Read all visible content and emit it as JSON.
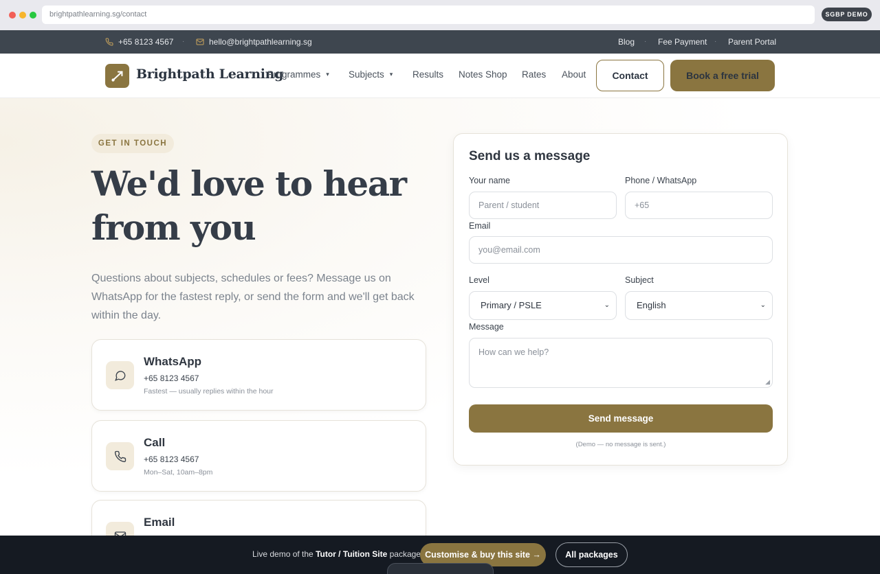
{
  "browser": {
    "url": "brightpathlearning.sg/contact",
    "badge": "SGBP DEMO"
  },
  "topbar": {
    "phone": "+65 8123 4567",
    "email": "hello@brightpathlearning.sg",
    "links": [
      "Blog",
      "Fee Payment",
      "Parent Portal"
    ]
  },
  "nav": {
    "brand": "Brightpath Learning",
    "items": [
      "Programmes",
      "Subjects",
      "Results",
      "Notes Shop",
      "Rates",
      "About"
    ],
    "contact_label": "Contact",
    "cta_label": "Book a free trial"
  },
  "hero": {
    "eyebrow": "GET IN TOUCH",
    "headline": "We'd love to hear from you",
    "lead": "Questions about subjects, schedules or fees? Message us on WhatsApp for the fastest reply, or send the form and we'll get back within the day."
  },
  "contacts": [
    {
      "title": "WhatsApp",
      "value": "+65 8123 4567",
      "note": "Fastest — usually replies within the hour"
    },
    {
      "title": "Call",
      "value": "+65 8123 4567",
      "note": "Mon–Sat, 10am–8pm"
    },
    {
      "title": "Email"
    }
  ],
  "form": {
    "title": "Send us a message",
    "name_label": "Your name",
    "name_placeholder": "Parent / student",
    "phone_label": "Phone / WhatsApp",
    "phone_placeholder": "+65",
    "email_label": "Email",
    "email_placeholder": "you@email.com",
    "level_label": "Level",
    "level_value": "Primary / PSLE",
    "subject_label": "Subject",
    "subject_value": "English",
    "message_label": "Message",
    "message_placeholder": "How can we help?",
    "submit_label": "Send message",
    "note": "(Demo — no message is sent.)"
  },
  "demo_bar": {
    "prefix": "Live demo of the ",
    "package": "Tutor / Tuition Site",
    "suffix": " package.",
    "customise_label": "Customise & buy this site →",
    "packages_label": "All packages"
  },
  "colors": {
    "accent": "#8a7540",
    "topbar_bg": "#3e464f",
    "demo_bar_bg": "#151a22"
  }
}
